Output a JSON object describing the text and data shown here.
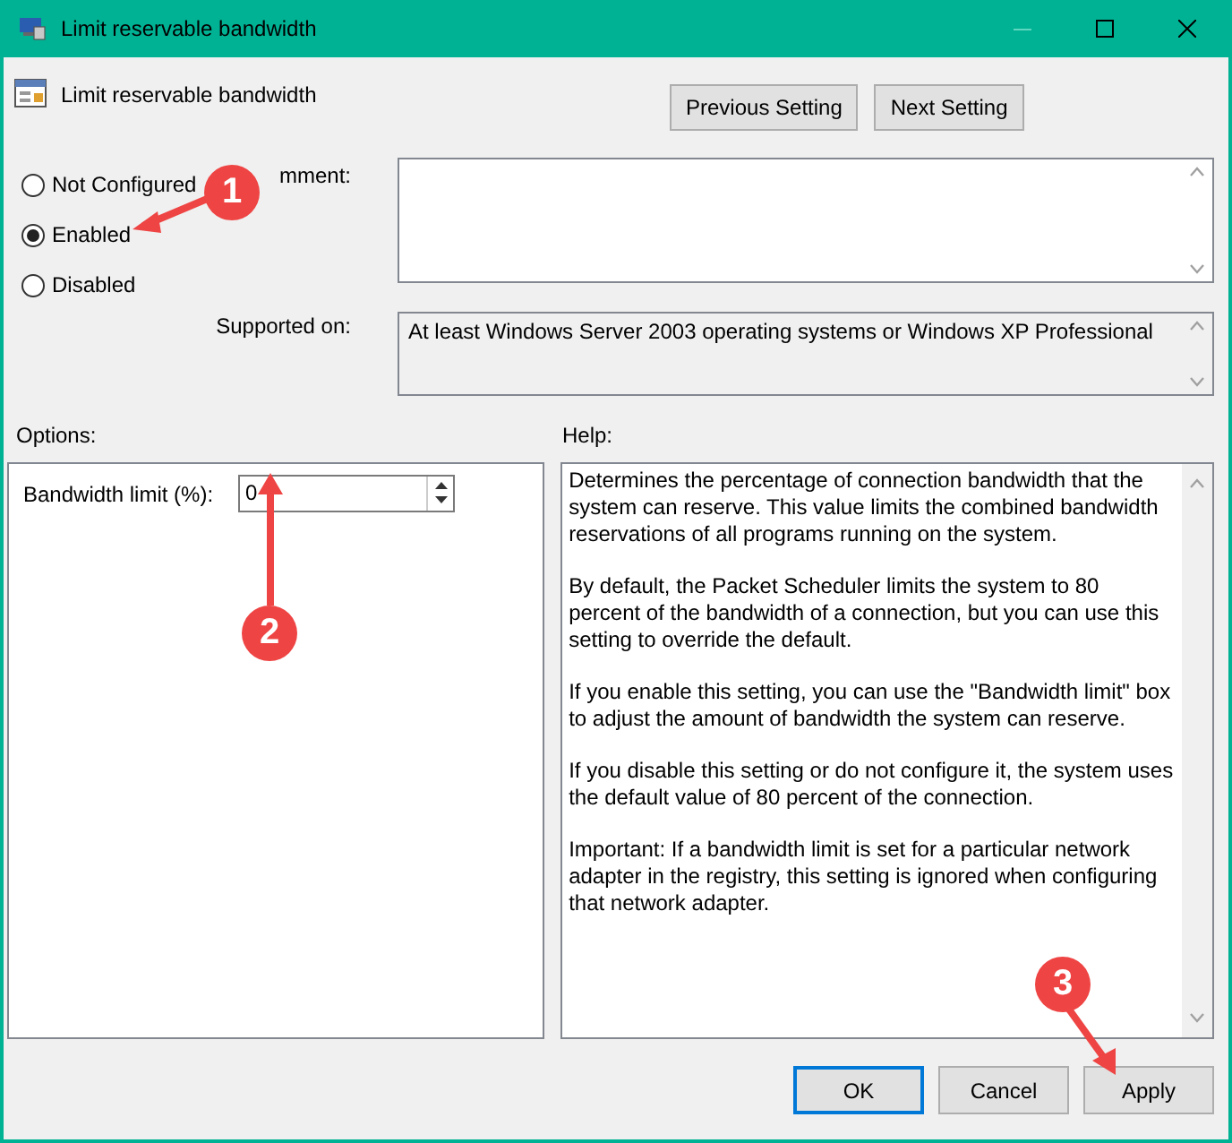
{
  "window": {
    "title": "Limit reservable bandwidth"
  },
  "policy": {
    "name": "Limit reservable bandwidth"
  },
  "nav_buttons": [
    "Previous Setting",
    "Next Setting"
  ],
  "state_options": [
    {
      "label": "Not Configured",
      "selected": false
    },
    {
      "label": "Enabled",
      "selected": true
    },
    {
      "label": "Disabled",
      "selected": false
    }
  ],
  "comment": {
    "label": "mment:"
  },
  "supported_on": {
    "label": "Supported on:",
    "value": "At least Windows Server 2003 operating systems or Windows XP Professional"
  },
  "options": {
    "label": "Options:",
    "fields": [
      {
        "label": "Bandwidth limit (%):",
        "value": "0"
      }
    ]
  },
  "help": {
    "label": "Help:",
    "paragraphs": [
      "Determines the percentage of connection bandwidth that the system can reserve. This value limits the combined bandwidth reservations of all programs running on the system.",
      "By default, the Packet Scheduler limits the system to 80 percent of the bandwidth of a connection, but you can use this setting to override the default.",
      "If you enable this setting, you can use the \"Bandwidth limit\" box to adjust the amount of bandwidth the system can reserve.",
      "If you disable this setting or do not configure it, the system uses the default value of 80 percent of the connection.",
      "Important: If a bandwidth limit is set for a particular network adapter in the registry, this setting is ignored when configuring that network adapter."
    ]
  },
  "buttons": [
    {
      "label": "OK",
      "default": true
    },
    {
      "label": "Cancel",
      "default": false
    },
    {
      "label": "Apply",
      "default": false
    }
  ],
  "annotations": [
    {
      "number": "1"
    },
    {
      "number": "2"
    },
    {
      "number": "3"
    }
  ]
}
